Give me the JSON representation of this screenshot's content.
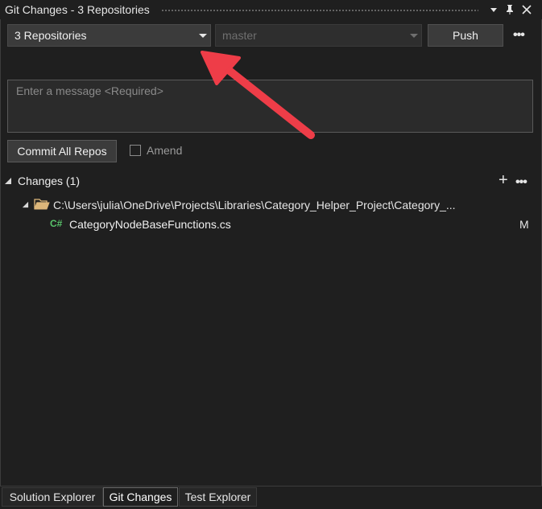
{
  "window": {
    "title": "Git Changes - 3 Repositories"
  },
  "toolbar": {
    "repo_selector": "3 Repositories",
    "branch_selector": "master",
    "push_label": "Push",
    "more_label": "•••"
  },
  "commit": {
    "message_placeholder": "Enter a message <Required>",
    "message_value": "",
    "commit_label": "Commit All Repos",
    "amend_label": "Amend",
    "amend_checked": false
  },
  "changes": {
    "header": "Changes (1)",
    "add_label": "+",
    "more_label": "•••",
    "folder_path": "C:\\Users\\julia\\OneDrive\\Projects\\Libraries\\Category_Helper_Project\\Category_...",
    "files": [
      {
        "language_badge": "C#",
        "name": "CategoryNodeBaseFunctions.cs",
        "status": "M"
      }
    ]
  },
  "bottom_tabs": [
    {
      "label": "Solution Explorer",
      "active": false
    },
    {
      "label": "Git Changes",
      "active": true
    },
    {
      "label": "Test Explorer",
      "active": false
    }
  ],
  "annotation": {
    "arrow_color": "#ee3d48"
  },
  "icons": {
    "dropdown": "chevron-down-icon",
    "pin": "pin-icon",
    "close": "close-icon",
    "collapse": "triangle-down-icon",
    "folder": "folder-open-icon"
  }
}
